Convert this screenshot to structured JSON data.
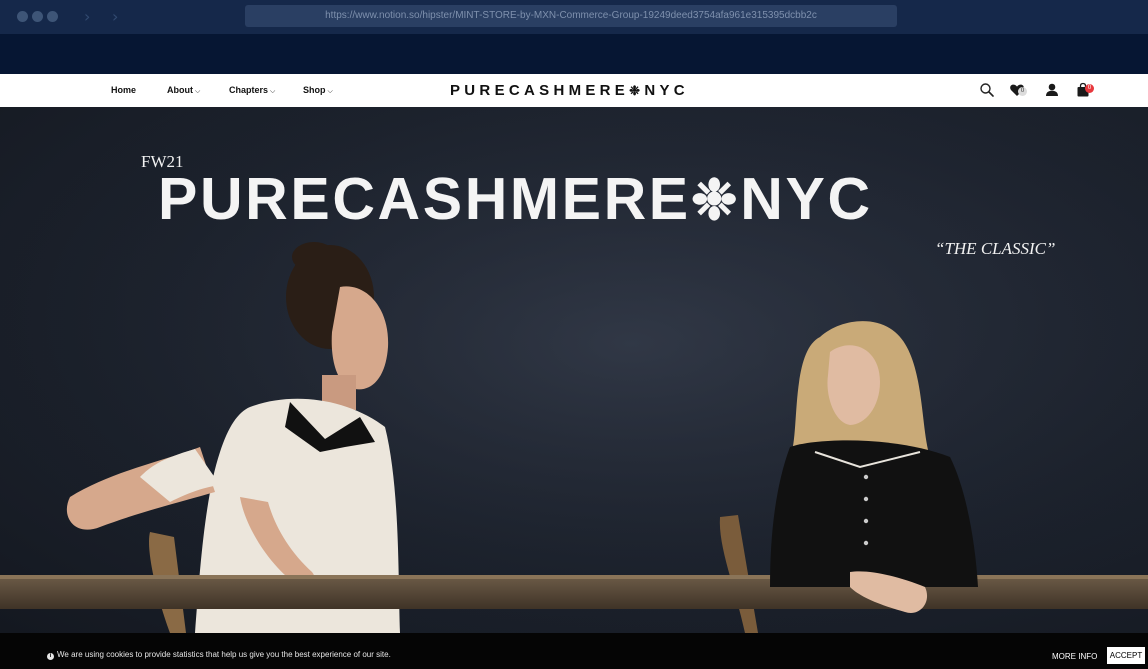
{
  "browser": {
    "url": "https://www.notion.so/hipster/MINT-STORE-by-MXN-Commerce-Group-19249deed3754afa961e315395dcbb2c"
  },
  "header": {
    "nav": [
      {
        "label": "Home"
      },
      {
        "label": "About"
      },
      {
        "label": "Chapters"
      },
      {
        "label": "Shop"
      }
    ],
    "logo_left": "PURECASHMERE",
    "logo_right": "NYC",
    "logo_flake": "❉",
    "icons": {
      "search": "search-icon",
      "wishlist": "heart-icon",
      "account": "user-icon",
      "cart": "shopping-bag-icon"
    },
    "wishlist_count": "0",
    "cart_count": "0",
    "cart_badge_color": "#e8383d"
  },
  "hero": {
    "season": "FW21",
    "brand_left": "PURECASHMERE",
    "brand_right": "NYC",
    "brand_flake": "❉",
    "tagline": "“THE CLASSIC”"
  },
  "cookie": {
    "text": "We are using cookies to provide statistics that help us give you the best experience of our site.",
    "more_info": "MORE INFO",
    "accept": "ACCEPT"
  }
}
